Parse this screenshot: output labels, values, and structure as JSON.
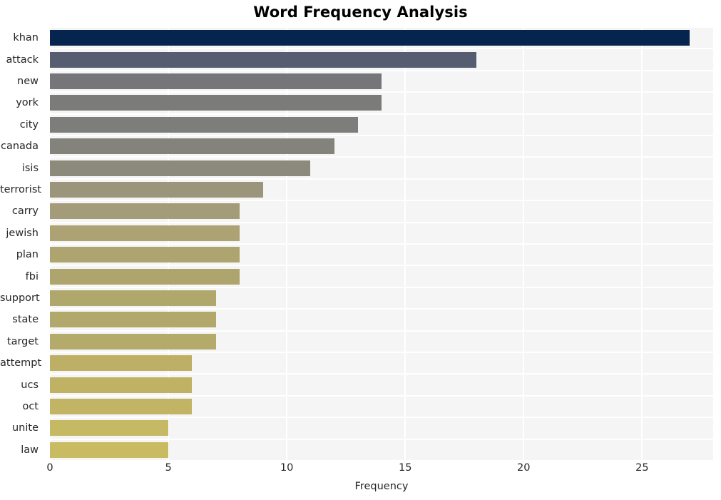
{
  "chart_data": {
    "type": "bar",
    "orientation": "horizontal",
    "title": "Word Frequency Analysis",
    "xlabel": "Frequency",
    "ylabel": "",
    "categories": [
      "khan",
      "attack",
      "new",
      "york",
      "city",
      "canada",
      "isis",
      "terrorist",
      "carry",
      "jewish",
      "plan",
      "fbi",
      "support",
      "state",
      "target",
      "attempt",
      "ucs",
      "oct",
      "unite",
      "law"
    ],
    "values": [
      27,
      18,
      14,
      14,
      13,
      12,
      11,
      9,
      8,
      8,
      8,
      8,
      7,
      7,
      7,
      6,
      6,
      6,
      5,
      5
    ],
    "xlim": [
      0,
      28
    ],
    "xticks": [
      0,
      5,
      10,
      15,
      20,
      25
    ],
    "xtick_labels": [
      "0",
      "5",
      "10",
      "15",
      "20",
      "25"
    ],
    "grid": true,
    "grid_color": "#ffffff",
    "plot_background": "#f5f5f5",
    "legend": null,
    "bar_colors": [
      "#05254f",
      "#575d70",
      "#76767a",
      "#7b7b7a",
      "#7d7d7b",
      "#83837c",
      "#8c8a7b",
      "#9a957b",
      "#a49c79",
      "#aca273",
      "#ada470",
      "#ada46e",
      "#b0a76c",
      "#b2a86b",
      "#b4aa6a",
      "#bdb066",
      "#bfb265",
      "#c1b464",
      "#c6b963",
      "#c8bb62"
    ]
  }
}
